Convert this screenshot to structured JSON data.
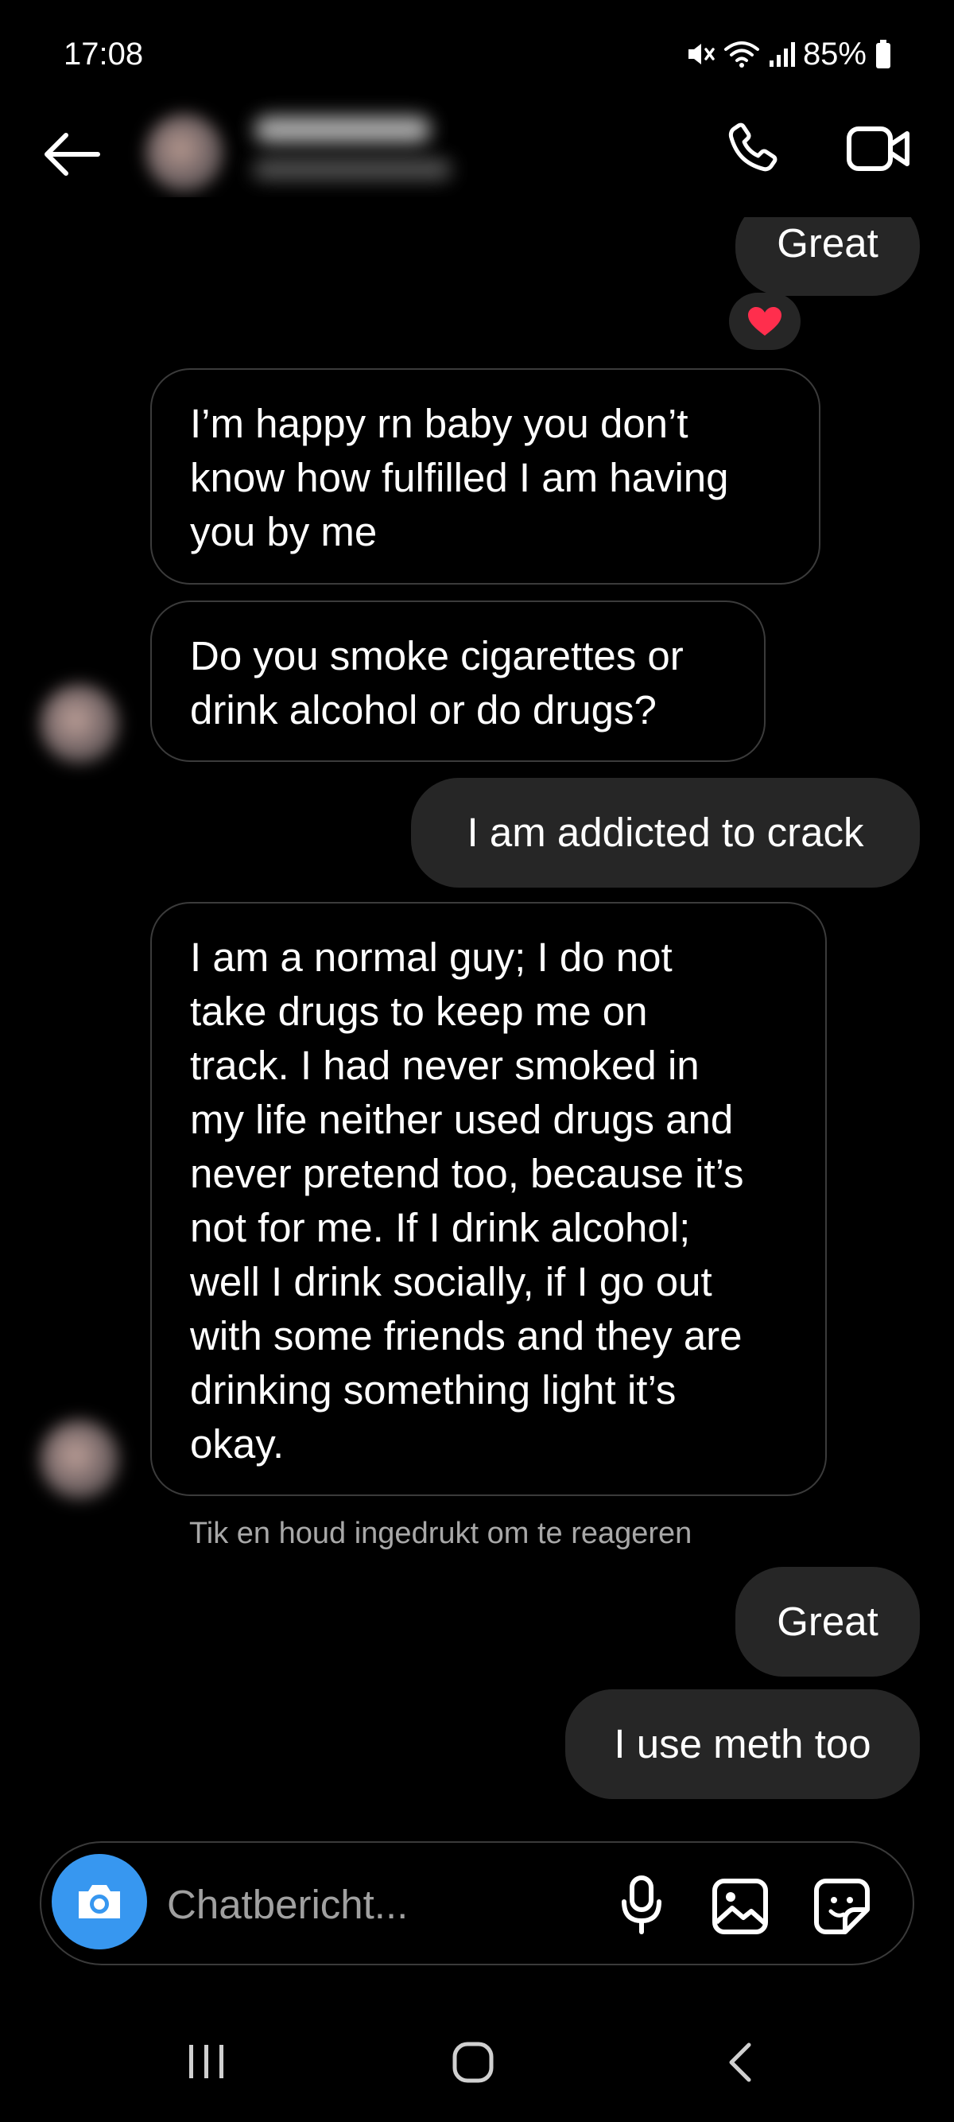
{
  "status_bar": {
    "time": "17:08",
    "battery": "85%",
    "icons": [
      "mute-icon",
      "wifi-icon",
      "signal-icon",
      "battery-icon"
    ]
  },
  "header": {
    "icons": [
      "back-arrow-icon",
      "phone-icon",
      "video-camera-icon"
    ]
  },
  "messages": [
    {
      "from": "me",
      "lines": [
        "Great"
      ],
      "reaction": "❤️"
    },
    {
      "from": "them",
      "lines": [
        "I’m happy rn baby you don’t",
        "know how fulfilled I am having",
        "you by me"
      ]
    },
    {
      "from": "them",
      "lines": [
        "Do you smoke cigarettes or",
        "drink alcohol or do drugs?"
      ]
    },
    {
      "from": "me",
      "lines": [
        "I am addicted to crack"
      ]
    },
    {
      "from": "them",
      "lines": [
        "I am a normal guy; I do not",
        "take drugs to keep me on",
        "track. I had never smoked in",
        "my life neither used drugs and",
        "never pretend too, because it’s",
        "not for me. If I drink alcohol;",
        "well I drink socially, if I go out",
        "with some friends and they are",
        "drinking something light it’s",
        "okay."
      ]
    },
    {
      "from": "me",
      "lines": [
        "Great"
      ]
    },
    {
      "from": "me",
      "lines": [
        "I use meth too"
      ]
    }
  ],
  "hint": "Tik en houd ingedrukt om te reageren",
  "composer": {
    "placeholder": "Chatbericht...",
    "accent_color": "#3797f0",
    "icons": [
      "camera-icon",
      "microphone-icon",
      "gallery-icon",
      "sticker-icon"
    ]
  },
  "nav_bar": {
    "icons": [
      "recents-icon",
      "home-icon",
      "back-icon"
    ]
  },
  "colors": {
    "background": "#000000",
    "outgoing_bubble": "#262626",
    "incoming_border": "#3b3b3b",
    "hint_text": "#a8a8a8"
  }
}
